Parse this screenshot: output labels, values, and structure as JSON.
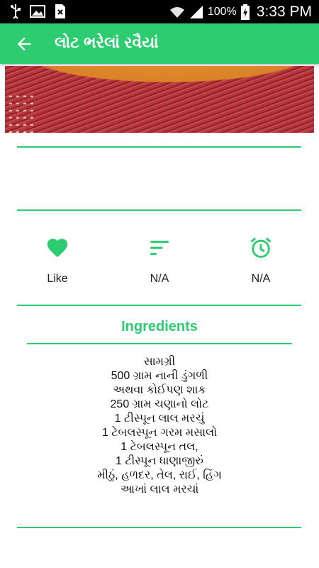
{
  "status_bar": {
    "battery": "100%",
    "time": "3:33 PM",
    "icons": [
      "usb-icon",
      "image-icon",
      "no-sim-icon",
      "wifi-icon",
      "signal-icon",
      "battery-charging-icon"
    ]
  },
  "app_bar": {
    "title": "લોટ ભરેલાં રવૈયાં",
    "back_icon": "arrow-left-icon"
  },
  "actions": [
    {
      "icon": "heart-icon",
      "label": "Like"
    },
    {
      "icon": "sort-lines-icon",
      "label": "N/A"
    },
    {
      "icon": "alarm-clock-icon",
      "label": "N/A"
    }
  ],
  "ingredients": {
    "title": "Ingredients",
    "lines": [
      "સામગ્રી",
      "500 ગ્રામ નાની ડુંગળી",
      "અથવા કોઈપણ શાક",
      "250 ગ્રામ ચણાનો લોટ",
      "1 ટીસ્પૂન લાલ મરચું",
      "1 ટેબલસ્પૂન ગરમ મસાલો",
      "1 ટેબલસ્પૂન તલ,",
      "1 ટીસ્પૂન ધાણાજીરું",
      "મીઠું, હળદર, તેલ, રાઈ, હિંગ",
      "આખાં લાલ મરચાં"
    ]
  },
  "colors": {
    "accent": "#2ecc71",
    "status_bar": "#000000",
    "text": "#222222"
  }
}
